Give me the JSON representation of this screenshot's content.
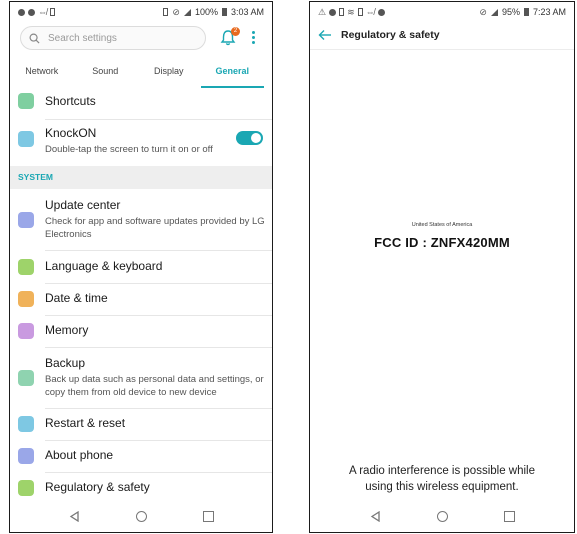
{
  "left_screen": {
    "status_time": "3:03 AM",
    "status_battery": "100%",
    "search": {
      "placeholder": "Search settings"
    },
    "notification_count": "2",
    "tabs": [
      {
        "label": "Network"
      },
      {
        "label": "Sound"
      },
      {
        "label": "Display"
      },
      {
        "label": "General"
      }
    ],
    "items": {
      "shortcuts": {
        "title": "Shortcuts"
      },
      "knockon": {
        "title": "KnockON",
        "subtitle": "Double-tap the screen to turn it on or off"
      },
      "section_system": "SYSTEM",
      "update_center": {
        "title": "Update center",
        "subtitle": "Check for app and software updates provided by LG Electronics"
      },
      "language": {
        "title": "Language & keyboard"
      },
      "date_time": {
        "title": "Date & time"
      },
      "memory": {
        "title": "Memory"
      },
      "backup": {
        "title": "Backup",
        "subtitle": "Back up data such as personal data and settings, or copy them from old device to new device"
      },
      "restart": {
        "title": "Restart & reset"
      },
      "about": {
        "title": "About phone"
      },
      "regulatory": {
        "title": "Regulatory & safety"
      }
    },
    "colors": {
      "accent": "#1aa7b3"
    }
  },
  "right_screen": {
    "status_time": "7:23 AM",
    "status_battery": "95%",
    "header_title": "Regulatory & safety",
    "country_label": "United States of America",
    "fcc_label": "FCC ID : ZNFX420MM",
    "notice": "A radio interference is possible while using this wireless equipment."
  }
}
